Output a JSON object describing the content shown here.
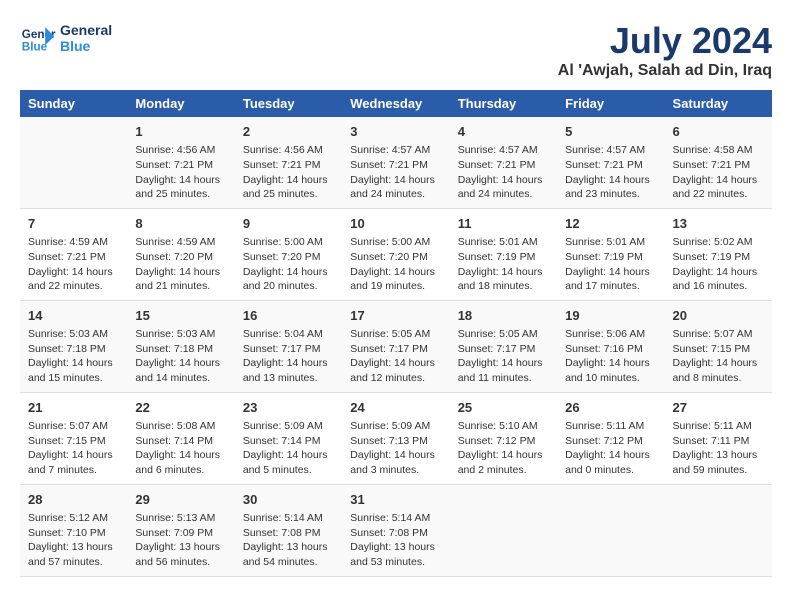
{
  "logo": {
    "text_general": "General",
    "text_blue": "Blue"
  },
  "title": {
    "month_year": "July 2024",
    "location": "Al 'Awjah, Salah ad Din, Iraq"
  },
  "header": {
    "days": [
      "Sunday",
      "Monday",
      "Tuesday",
      "Wednesday",
      "Thursday",
      "Friday",
      "Saturday"
    ]
  },
  "weeks": [
    {
      "cells": [
        {
          "day": "",
          "content": ""
        },
        {
          "day": "1",
          "content": "Sunrise: 4:56 AM\nSunset: 7:21 PM\nDaylight: 14 hours\nand 25 minutes."
        },
        {
          "day": "2",
          "content": "Sunrise: 4:56 AM\nSunset: 7:21 PM\nDaylight: 14 hours\nand 25 minutes."
        },
        {
          "day": "3",
          "content": "Sunrise: 4:57 AM\nSunset: 7:21 PM\nDaylight: 14 hours\nand 24 minutes."
        },
        {
          "day": "4",
          "content": "Sunrise: 4:57 AM\nSunset: 7:21 PM\nDaylight: 14 hours\nand 24 minutes."
        },
        {
          "day": "5",
          "content": "Sunrise: 4:57 AM\nSunset: 7:21 PM\nDaylight: 14 hours\nand 23 minutes."
        },
        {
          "day": "6",
          "content": "Sunrise: 4:58 AM\nSunset: 7:21 PM\nDaylight: 14 hours\nand 22 minutes."
        }
      ]
    },
    {
      "cells": [
        {
          "day": "7",
          "content": "Sunrise: 4:59 AM\nSunset: 7:21 PM\nDaylight: 14 hours\nand 22 minutes."
        },
        {
          "day": "8",
          "content": "Sunrise: 4:59 AM\nSunset: 7:20 PM\nDaylight: 14 hours\nand 21 minutes."
        },
        {
          "day": "9",
          "content": "Sunrise: 5:00 AM\nSunset: 7:20 PM\nDaylight: 14 hours\nand 20 minutes."
        },
        {
          "day": "10",
          "content": "Sunrise: 5:00 AM\nSunset: 7:20 PM\nDaylight: 14 hours\nand 19 minutes."
        },
        {
          "day": "11",
          "content": "Sunrise: 5:01 AM\nSunset: 7:19 PM\nDaylight: 14 hours\nand 18 minutes."
        },
        {
          "day": "12",
          "content": "Sunrise: 5:01 AM\nSunset: 7:19 PM\nDaylight: 14 hours\nand 17 minutes."
        },
        {
          "day": "13",
          "content": "Sunrise: 5:02 AM\nSunset: 7:19 PM\nDaylight: 14 hours\nand 16 minutes."
        }
      ]
    },
    {
      "cells": [
        {
          "day": "14",
          "content": "Sunrise: 5:03 AM\nSunset: 7:18 PM\nDaylight: 14 hours\nand 15 minutes."
        },
        {
          "day": "15",
          "content": "Sunrise: 5:03 AM\nSunset: 7:18 PM\nDaylight: 14 hours\nand 14 minutes."
        },
        {
          "day": "16",
          "content": "Sunrise: 5:04 AM\nSunset: 7:17 PM\nDaylight: 14 hours\nand 13 minutes."
        },
        {
          "day": "17",
          "content": "Sunrise: 5:05 AM\nSunset: 7:17 PM\nDaylight: 14 hours\nand 12 minutes."
        },
        {
          "day": "18",
          "content": "Sunrise: 5:05 AM\nSunset: 7:17 PM\nDaylight: 14 hours\nand 11 minutes."
        },
        {
          "day": "19",
          "content": "Sunrise: 5:06 AM\nSunset: 7:16 PM\nDaylight: 14 hours\nand 10 minutes."
        },
        {
          "day": "20",
          "content": "Sunrise: 5:07 AM\nSunset: 7:15 PM\nDaylight: 14 hours\nand 8 minutes."
        }
      ]
    },
    {
      "cells": [
        {
          "day": "21",
          "content": "Sunrise: 5:07 AM\nSunset: 7:15 PM\nDaylight: 14 hours\nand 7 minutes."
        },
        {
          "day": "22",
          "content": "Sunrise: 5:08 AM\nSunset: 7:14 PM\nDaylight: 14 hours\nand 6 minutes."
        },
        {
          "day": "23",
          "content": "Sunrise: 5:09 AM\nSunset: 7:14 PM\nDaylight: 14 hours\nand 5 minutes."
        },
        {
          "day": "24",
          "content": "Sunrise: 5:09 AM\nSunset: 7:13 PM\nDaylight: 14 hours\nand 3 minutes."
        },
        {
          "day": "25",
          "content": "Sunrise: 5:10 AM\nSunset: 7:12 PM\nDaylight: 14 hours\nand 2 minutes."
        },
        {
          "day": "26",
          "content": "Sunrise: 5:11 AM\nSunset: 7:12 PM\nDaylight: 14 hours\nand 0 minutes."
        },
        {
          "day": "27",
          "content": "Sunrise: 5:11 AM\nSunset: 7:11 PM\nDaylight: 13 hours\nand 59 minutes."
        }
      ]
    },
    {
      "cells": [
        {
          "day": "28",
          "content": "Sunrise: 5:12 AM\nSunset: 7:10 PM\nDaylight: 13 hours\nand 57 minutes."
        },
        {
          "day": "29",
          "content": "Sunrise: 5:13 AM\nSunset: 7:09 PM\nDaylight: 13 hours\nand 56 minutes."
        },
        {
          "day": "30",
          "content": "Sunrise: 5:14 AM\nSunset: 7:08 PM\nDaylight: 13 hours\nand 54 minutes."
        },
        {
          "day": "31",
          "content": "Sunrise: 5:14 AM\nSunset: 7:08 PM\nDaylight: 13 hours\nand 53 minutes."
        },
        {
          "day": "",
          "content": ""
        },
        {
          "day": "",
          "content": ""
        },
        {
          "day": "",
          "content": ""
        }
      ]
    }
  ]
}
